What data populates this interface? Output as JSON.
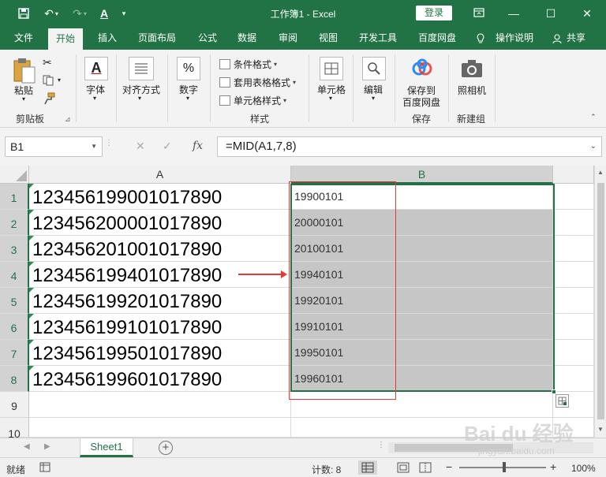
{
  "titlebar": {
    "title": "工作簿1 - Excel",
    "login_label": "登录"
  },
  "tabs": [
    "文件",
    "开始",
    "插入",
    "页面布局",
    "公式",
    "数据",
    "审阅",
    "视图",
    "开发工具",
    "百度网盘",
    "操作说明",
    "共享"
  ],
  "ribbon": {
    "paste_label": "粘贴",
    "clipboard_group": "剪贴板",
    "font_label": "字体",
    "align_label": "对齐方式",
    "number_label": "数字",
    "conditional_format": "条件格式",
    "table_format": "套用表格格式",
    "cell_style": "单元格样式",
    "styles_group": "样式",
    "cells_label": "单元格",
    "edit_label": "编辑",
    "save_baidu_line1": "保存到",
    "save_baidu_line2": "百度网盘",
    "save_group": "保存",
    "camera_label": "照相机",
    "new_group": "新建组"
  },
  "formula_bar": {
    "name_box": "B1",
    "fx_label": "fx",
    "formula": "=MID(A1,7,8)"
  },
  "columns": [
    "A",
    "B"
  ],
  "rows": [
    {
      "num": "1",
      "a": "123456199001017890",
      "b": "19900101"
    },
    {
      "num": "2",
      "a": "123456200001017890",
      "b": "20000101"
    },
    {
      "num": "3",
      "a": "123456201001017890",
      "b": "20100101"
    },
    {
      "num": "4",
      "a": "123456199401017890",
      "b": "19940101"
    },
    {
      "num": "5",
      "a": "123456199201017890",
      "b": "19920101"
    },
    {
      "num": "6",
      "a": "123456199101017890",
      "b": "19910101"
    },
    {
      "num": "7",
      "a": "123456199501017890",
      "b": "19950101"
    },
    {
      "num": "8",
      "a": "123456199601017890",
      "b": "19960101"
    },
    {
      "num": "9",
      "a": "",
      "b": ""
    },
    {
      "num": "10",
      "a": "",
      "b": ""
    }
  ],
  "sheet_tabs": {
    "active": "Sheet1",
    "add_label": "+"
  },
  "statusbar": {
    "ready": "就绪",
    "count": "计数: 8",
    "zoom": "100%"
  },
  "watermark": {
    "logo": "Bai du 经验",
    "url": "jingyan.baidu.com"
  },
  "colors": {
    "excel_green": "#217346",
    "selection_gray": "#c6c6c6",
    "annotation_red": "#e53935"
  }
}
